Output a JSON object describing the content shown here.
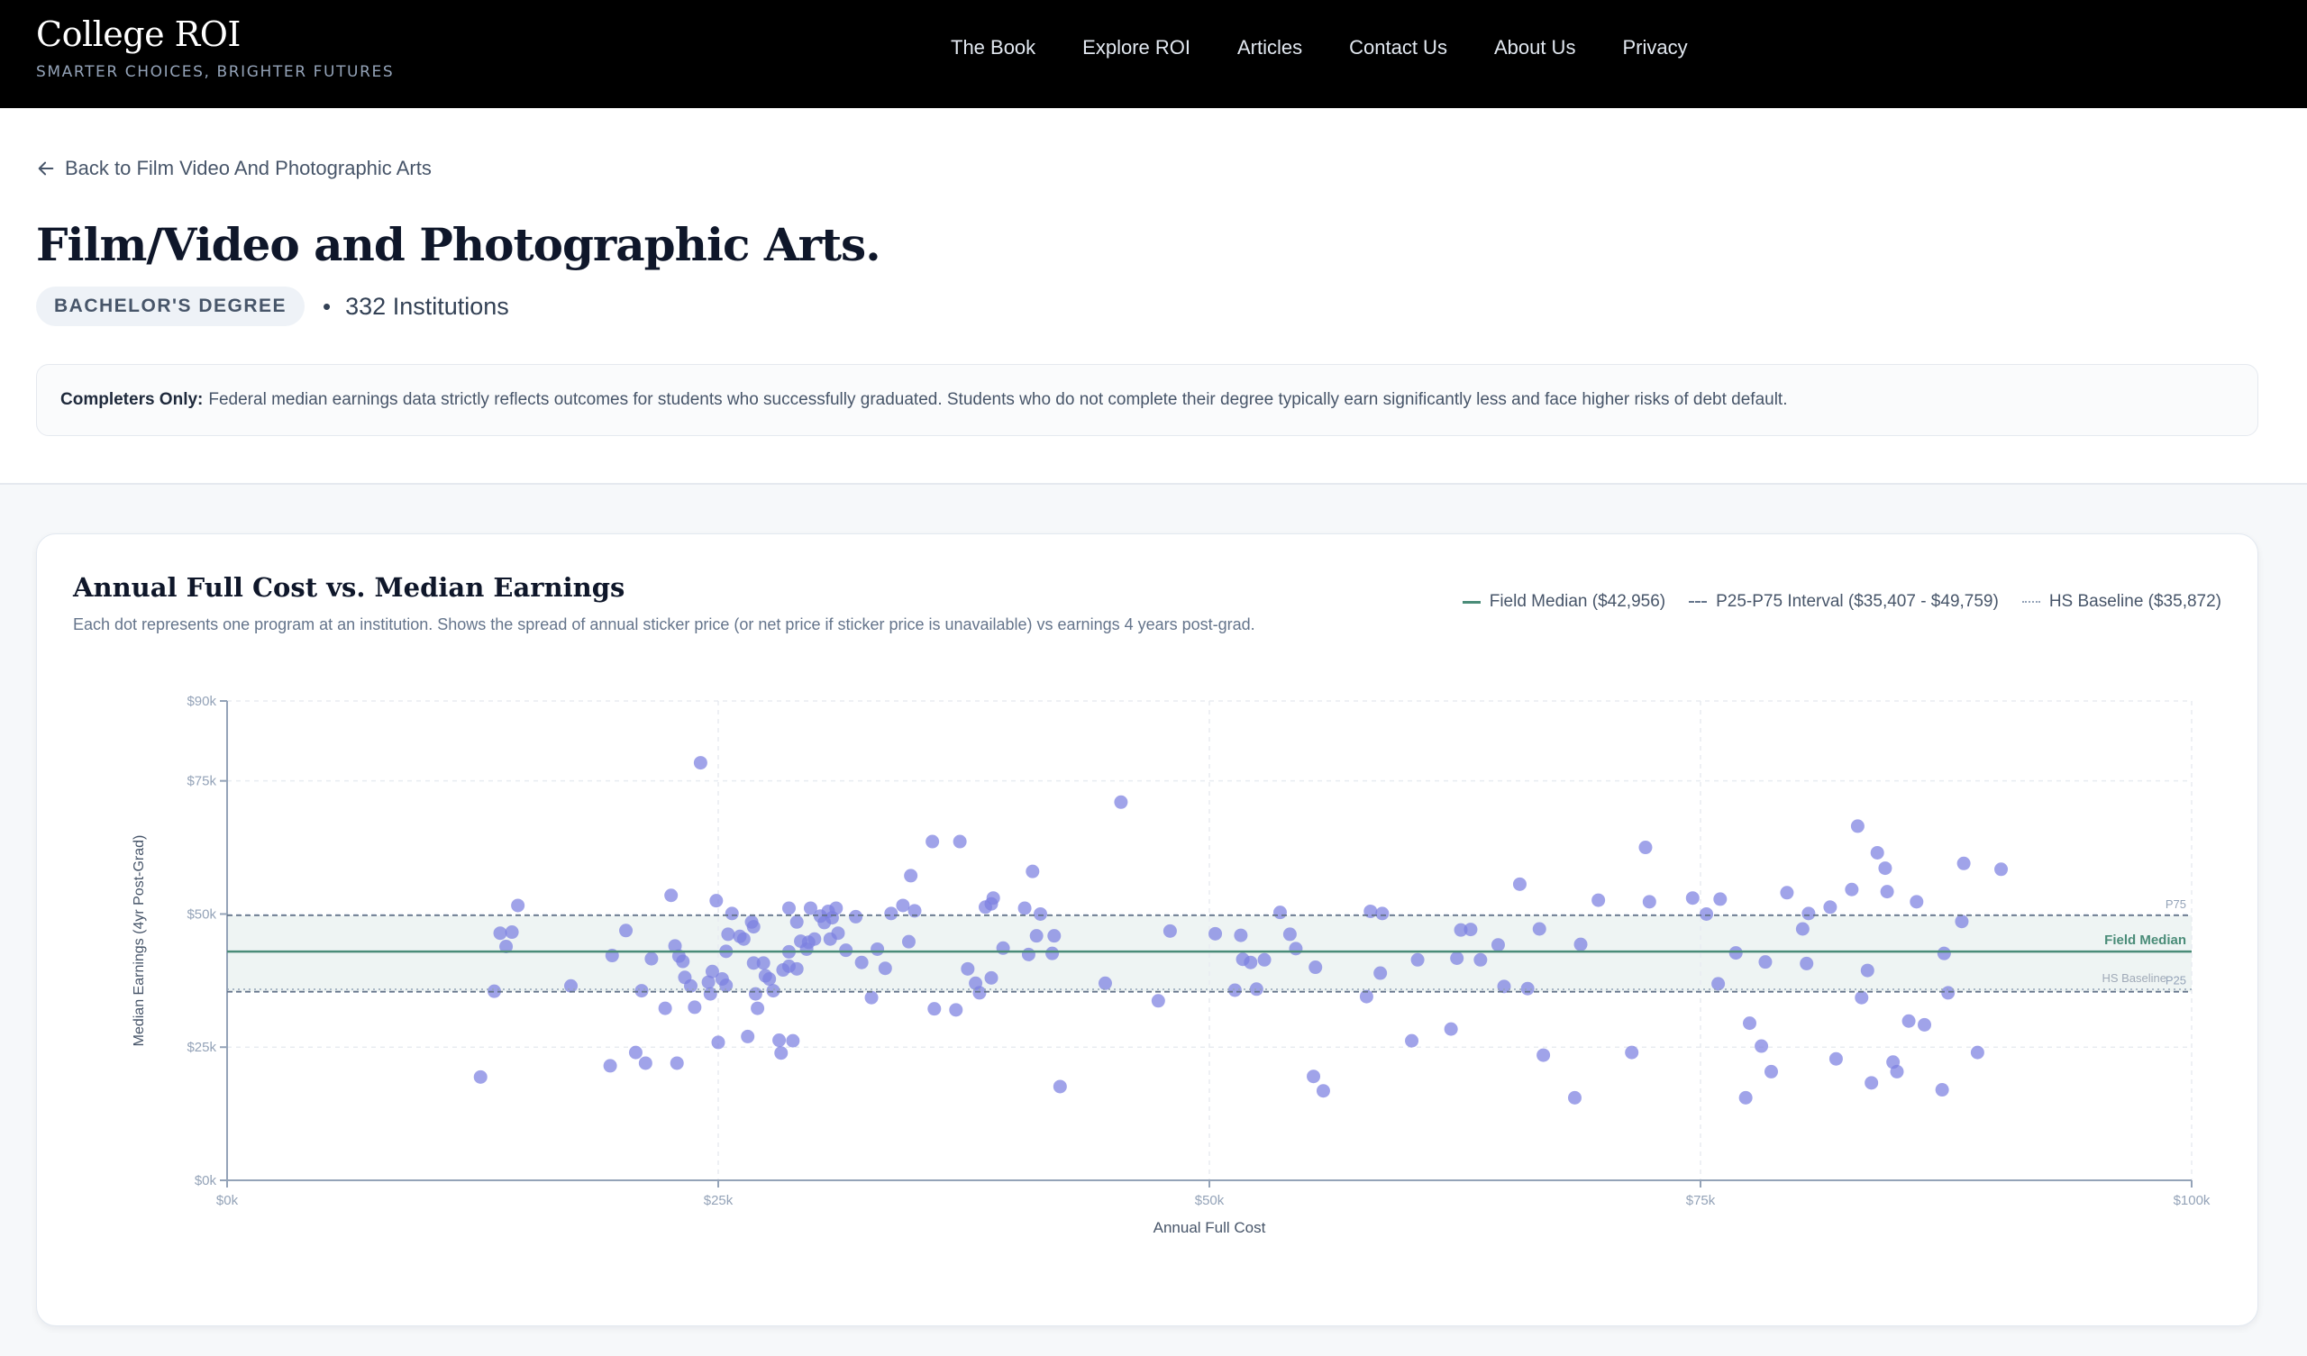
{
  "header": {
    "brand_name": "College ROI",
    "tagline": "SMARTER CHOICES, BRIGHTER FUTURES",
    "nav": [
      "The Book",
      "Explore ROI",
      "Articles",
      "Contact Us",
      "About Us",
      "Privacy"
    ]
  },
  "back_link": "Back to Film Video And Photographic Arts",
  "title": "Film/Video and Photographic Arts.",
  "degree_badge": "BACHELOR'S DEGREE",
  "separator": "•",
  "institutions": "332 Institutions",
  "notice": {
    "label": "Completers Only:",
    "text": "Federal median earnings data strictly reflects outcomes for students who successfully graduated. Students who do not complete their degree typically earn significantly less and face higher risks of debt default."
  },
  "chart_card": {
    "title": "Annual Full Cost vs. Median Earnings",
    "subtitle": "Each dot represents one program at an institution. Shows the spread of annual sticker price (or net price if sticker price is unavailable) vs earnings 4 years post-grad.",
    "legend": [
      "Field Median ($42,956)",
      "P25-P75 Interval ($35,407 - $49,759)",
      "HS Baseline ($35,872)"
    ]
  },
  "colors": {
    "dot": "#7b7fe0",
    "median_line": "#4a8c78",
    "interval_line": "#64748b",
    "band": "#eef4f3"
  },
  "chart_data": {
    "type": "scatter",
    "title": "Annual Full Cost vs. Median Earnings",
    "xlabel": "Annual Full Cost",
    "ylabel": "Median Earnings (4yr Post-Grad)",
    "xlim": [
      0,
      100000
    ],
    "ylim": [
      0,
      90000
    ],
    "x_ticks": [
      "$0k",
      "$25k",
      "$50k",
      "$75k",
      "$100k"
    ],
    "y_ticks": [
      "$0k",
      "$25k",
      "$50k",
      "$75k",
      "$90k"
    ],
    "x_tick_values": [
      0,
      25000,
      50000,
      75000,
      100000
    ],
    "y_tick_values": [
      0,
      25000,
      50000,
      75000,
      90000
    ],
    "grid": true,
    "reference_lines": [
      {
        "label": "P75",
        "value": 49759,
        "style": "dashed"
      },
      {
        "label": "Field Median",
        "value": 42956,
        "style": "solid"
      },
      {
        "label": "HS Baseline",
        "value": 35872,
        "style": "dotted"
      },
      {
        "label": "P25",
        "value": 35407,
        "style": "dashed"
      }
    ],
    "points": [
      [
        12900,
        19400
      ],
      [
        13600,
        35500
      ],
      [
        13900,
        46400
      ],
      [
        14200,
        43900
      ],
      [
        14500,
        46600
      ],
      [
        14800,
        51600
      ],
      [
        17500,
        36500
      ],
      [
        19500,
        21500
      ],
      [
        19600,
        42200
      ],
      [
        20300,
        46900
      ],
      [
        20800,
        24000
      ],
      [
        21100,
        35600
      ],
      [
        21300,
        22000
      ],
      [
        21600,
        41600
      ],
      [
        22300,
        32300
      ],
      [
        22600,
        53500
      ],
      [
        22800,
        44000
      ],
      [
        22900,
        22000
      ],
      [
        23000,
        42100
      ],
      [
        23200,
        41100
      ],
      [
        23300,
        38100
      ],
      [
        23600,
        36500
      ],
      [
        23800,
        32500
      ],
      [
        24100,
        78400
      ],
      [
        24500,
        37200
      ],
      [
        24600,
        35000
      ],
      [
        24700,
        39200
      ],
      [
        24900,
        52500
      ],
      [
        25000,
        25900
      ],
      [
        25200,
        37800
      ],
      [
        25400,
        36600
      ],
      [
        25400,
        43000
      ],
      [
        25500,
        46200
      ],
      [
        25700,
        50100
      ],
      [
        26100,
        45800
      ],
      [
        26300,
        45300
      ],
      [
        26500,
        27000
      ],
      [
        26700,
        48500
      ],
      [
        26800,
        40800
      ],
      [
        26800,
        47600
      ],
      [
        26900,
        35000
      ],
      [
        27000,
        32300
      ],
      [
        27300,
        40800
      ],
      [
        27400,
        38400
      ],
      [
        27600,
        37800
      ],
      [
        27800,
        35600
      ],
      [
        28100,
        26300
      ],
      [
        28200,
        23900
      ],
      [
        28300,
        39500
      ],
      [
        28600,
        40200
      ],
      [
        28600,
        42900
      ],
      [
        28600,
        51100
      ],
      [
        28800,
        26200
      ],
      [
        29000,
        48500
      ],
      [
        29000,
        39700
      ],
      [
        29200,
        44900
      ],
      [
        29500,
        43400
      ],
      [
        29600,
        44700
      ],
      [
        29700,
        51100
      ],
      [
        29900,
        45300
      ],
      [
        30200,
        49600
      ],
      [
        30400,
        48400
      ],
      [
        30600,
        50500
      ],
      [
        30700,
        45300
      ],
      [
        30800,
        49300
      ],
      [
        31000,
        51100
      ],
      [
        31100,
        46400
      ],
      [
        31500,
        43200
      ],
      [
        32000,
        49500
      ],
      [
        32300,
        40900
      ],
      [
        32800,
        34300
      ],
      [
        33100,
        43400
      ],
      [
        33500,
        39800
      ],
      [
        33800,
        50100
      ],
      [
        34400,
        51600
      ],
      [
        34700,
        44800
      ],
      [
        34800,
        57200
      ],
      [
        35000,
        50600
      ],
      [
        35900,
        63600
      ],
      [
        36000,
        32200
      ],
      [
        37100,
        32000
      ],
      [
        37300,
        63600
      ],
      [
        37700,
        39700
      ],
      [
        38100,
        37000
      ],
      [
        38300,
        35200
      ],
      [
        38600,
        51300
      ],
      [
        38900,
        38000
      ],
      [
        38900,
        51900
      ],
      [
        39000,
        53000
      ],
      [
        39500,
        43600
      ],
      [
        40600,
        51100
      ],
      [
        40800,
        42400
      ],
      [
        41000,
        58000
      ],
      [
        41200,
        45900
      ],
      [
        41400,
        50000
      ],
      [
        42000,
        42600
      ],
      [
        42100,
        45900
      ],
      [
        42400,
        17600
      ],
      [
        44700,
        37000
      ],
      [
        45500,
        71000
      ],
      [
        47400,
        33700
      ],
      [
        48000,
        46800
      ],
      [
        50300,
        46300
      ],
      [
        51300,
        35700
      ],
      [
        51600,
        46000
      ],
      [
        51700,
        41500
      ],
      [
        52100,
        40900
      ],
      [
        52400,
        35900
      ],
      [
        52800,
        41400
      ],
      [
        53600,
        50300
      ],
      [
        54100,
        46200
      ],
      [
        54400,
        43500
      ],
      [
        55300,
        19500
      ],
      [
        55400,
        40000
      ],
      [
        55800,
        16800
      ],
      [
        58000,
        34500
      ],
      [
        58200,
        50500
      ],
      [
        58700,
        38900
      ],
      [
        58800,
        50100
      ],
      [
        60300,
        26200
      ],
      [
        60600,
        41400
      ],
      [
        62300,
        28400
      ],
      [
        62600,
        41700
      ],
      [
        62800,
        47000
      ],
      [
        63300,
        47100
      ],
      [
        63800,
        41400
      ],
      [
        64700,
        44200
      ],
      [
        65000,
        36400
      ],
      [
        65800,
        55600
      ],
      [
        66200,
        36000
      ],
      [
        66800,
        47200
      ],
      [
        67000,
        23500
      ],
      [
        68600,
        15500
      ],
      [
        68900,
        44300
      ],
      [
        69800,
        52600
      ],
      [
        71500,
        24000
      ],
      [
        72200,
        62500
      ],
      [
        72400,
        52300
      ],
      [
        74600,
        53000
      ],
      [
        75300,
        50000
      ],
      [
        75900,
        36900
      ],
      [
        76000,
        52800
      ],
      [
        76800,
        42700
      ],
      [
        77300,
        15500
      ],
      [
        77500,
        29500
      ],
      [
        78100,
        25200
      ],
      [
        78300,
        41000
      ],
      [
        78600,
        20400
      ],
      [
        79400,
        54000
      ],
      [
        80200,
        47200
      ],
      [
        80400,
        40700
      ],
      [
        80500,
        50100
      ],
      [
        81600,
        51300
      ],
      [
        81900,
        22800
      ],
      [
        82700,
        54600
      ],
      [
        83200,
        34300
      ],
      [
        83000,
        66500
      ],
      [
        83500,
        39400
      ],
      [
        83700,
        18300
      ],
      [
        84000,
        61500
      ],
      [
        84400,
        58600
      ],
      [
        84500,
        54200
      ],
      [
        84800,
        22200
      ],
      [
        85000,
        20400
      ],
      [
        85600,
        29900
      ],
      [
        86000,
        52300
      ],
      [
        86400,
        29200
      ],
      [
        87300,
        17000
      ],
      [
        87400,
        42600
      ],
      [
        87600,
        35200
      ],
      [
        88300,
        48600
      ],
      [
        88400,
        59500
      ],
      [
        89100,
        24000
      ],
      [
        90300,
        58400
      ]
    ]
  }
}
